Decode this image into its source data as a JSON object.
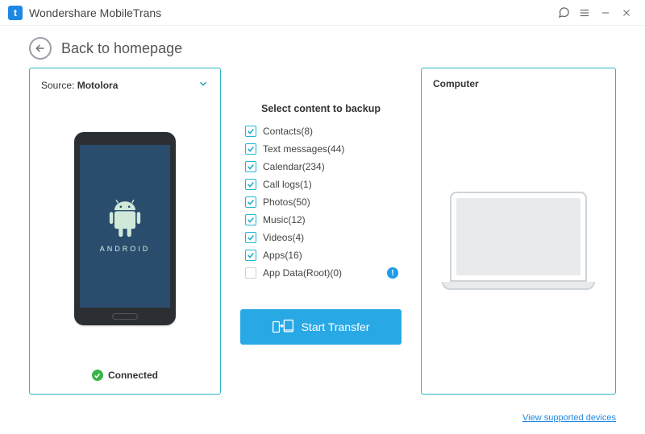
{
  "app": {
    "logo_letter": "t",
    "title": "Wondershare MobileTrans"
  },
  "back": {
    "label": "Back to homepage"
  },
  "source": {
    "label_prefix": "Source: ",
    "device_name": "Motolora",
    "android_label": "ANDROID",
    "connected_label": "Connected"
  },
  "content": {
    "title": "Select content to backup",
    "items": [
      {
        "label": "Contacts(8)",
        "checked": true,
        "info": false
      },
      {
        "label": "Text messages(44)",
        "checked": true,
        "info": false
      },
      {
        "label": "Calendar(234)",
        "checked": true,
        "info": false
      },
      {
        "label": "Call logs(1)",
        "checked": true,
        "info": false
      },
      {
        "label": "Photos(50)",
        "checked": true,
        "info": false
      },
      {
        "label": "Music(12)",
        "checked": true,
        "info": false
      },
      {
        "label": "Videos(4)",
        "checked": true,
        "info": false
      },
      {
        "label": "Apps(16)",
        "checked": true,
        "info": false
      },
      {
        "label": "App Data(Root)(0)",
        "checked": false,
        "info": true
      }
    ],
    "start_button": "Start Transfer"
  },
  "destination": {
    "label": "Computer"
  },
  "footer": {
    "link": "View supported devices"
  }
}
